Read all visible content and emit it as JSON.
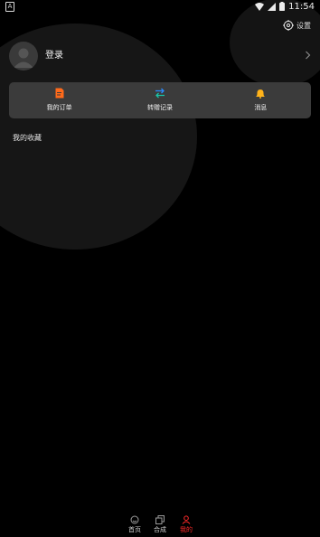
{
  "status_bar": {
    "time": "11:54",
    "left_icon_letter": "A"
  },
  "header": {
    "settings_label": "设置"
  },
  "profile": {
    "login_label": "登录"
  },
  "quick_actions": [
    {
      "label": "我的订单",
      "icon": "order-icon"
    },
    {
      "label": "转赠记录",
      "icon": "transfer-icon"
    },
    {
      "label": "消息",
      "icon": "bell-icon"
    }
  ],
  "favorites": {
    "title": "我的收藏"
  },
  "bottom_nav": [
    {
      "label": "首页",
      "icon": "home-icon",
      "active": false
    },
    {
      "label": "合成",
      "icon": "compose-icon",
      "active": false
    },
    {
      "label": "我的",
      "icon": "user-icon",
      "active": true
    }
  ],
  "colors": {
    "accent": "#ff2a2a",
    "order_icon": "#ff6a1a",
    "transfer_icon": "#2a8cff",
    "bell_icon": "#ffb31a",
    "card_bg": "#3b3b3b"
  }
}
